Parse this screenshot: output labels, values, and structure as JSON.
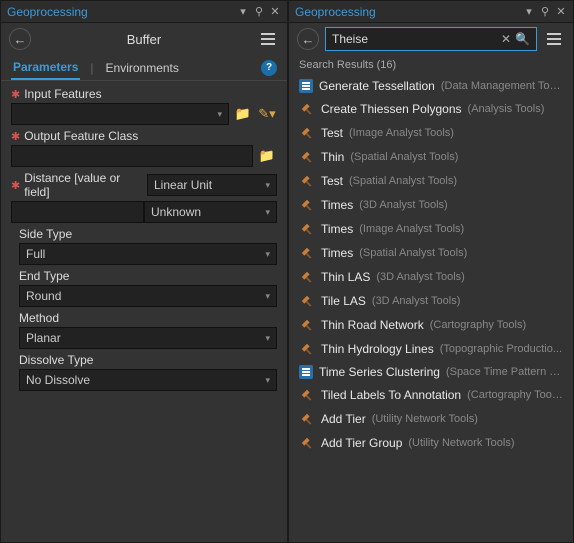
{
  "left": {
    "panel_title": "Geoprocessing",
    "tool_title": "Buffer",
    "tabs": {
      "parameters": "Parameters",
      "environments": "Environments"
    },
    "fields": {
      "input_features": {
        "label": "Input Features",
        "value": ""
      },
      "output_fc": {
        "label": "Output Feature Class",
        "value": ""
      },
      "distance": {
        "label": "Distance [value or field]",
        "mode": "Linear Unit",
        "value": "",
        "unit": "Unknown"
      },
      "side_type": {
        "label": "Side Type",
        "value": "Full"
      },
      "end_type": {
        "label": "End Type",
        "value": "Round"
      },
      "method": {
        "label": "Method",
        "value": "Planar"
      },
      "dissolve_type": {
        "label": "Dissolve Type",
        "value": "No Dissolve"
      }
    }
  },
  "right": {
    "panel_title": "Geoprocessing",
    "search_value": "Theise",
    "results_header": "Search Results (16)",
    "results": [
      {
        "icon": "script",
        "name": "Generate Tessellation",
        "cat": "(Data Management Tools)"
      },
      {
        "icon": "hammer",
        "name": "Create Thiessen Polygons",
        "cat": "(Analysis Tools)"
      },
      {
        "icon": "hammer",
        "name": "Test",
        "cat": "(Image Analyst Tools)"
      },
      {
        "icon": "hammer",
        "name": "Thin",
        "cat": "(Spatial Analyst Tools)"
      },
      {
        "icon": "hammer",
        "name": "Test",
        "cat": "(Spatial Analyst Tools)"
      },
      {
        "icon": "hammer",
        "name": "Times",
        "cat": "(3D Analyst Tools)"
      },
      {
        "icon": "hammer",
        "name": "Times",
        "cat": "(Image Analyst Tools)"
      },
      {
        "icon": "hammer",
        "name": "Times",
        "cat": "(Spatial Analyst Tools)"
      },
      {
        "icon": "hammer",
        "name": "Thin LAS",
        "cat": "(3D Analyst Tools)"
      },
      {
        "icon": "hammer",
        "name": "Tile LAS",
        "cat": "(3D Analyst Tools)"
      },
      {
        "icon": "hammer",
        "name": "Thin Road Network",
        "cat": "(Cartography Tools)"
      },
      {
        "icon": "hammer",
        "name": "Thin Hydrology Lines",
        "cat": "(Topographic Productio..."
      },
      {
        "icon": "script",
        "name": "Time Series Clustering",
        "cat": "(Space Time Pattern Mini..."
      },
      {
        "icon": "hammer",
        "name": "Tiled Labels To Annotation",
        "cat": "(Cartography Tools)"
      },
      {
        "icon": "hammer",
        "name": "Add Tier",
        "cat": "(Utility Network Tools)"
      },
      {
        "icon": "hammer",
        "name": "Add Tier Group",
        "cat": "(Utility Network Tools)"
      }
    ]
  }
}
